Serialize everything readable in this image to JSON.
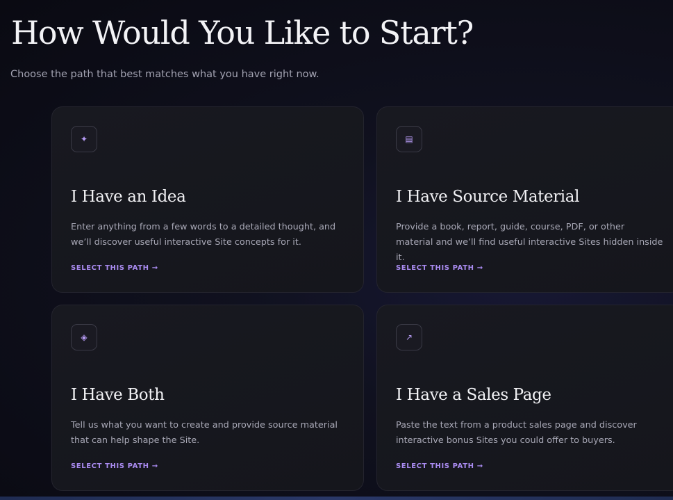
{
  "header": {
    "title": "How Would You Like to Start?",
    "subtitle": "Choose the path that best matches what you have right now."
  },
  "cards": [
    {
      "icon": "sparkle-icon",
      "glyph": "✦",
      "title": "I Have an Idea",
      "description": "Enter anything from a few words to a detailed thought, and we’ll discover useful interactive Site concepts for it.",
      "link": "SELECT THIS PATH →"
    },
    {
      "icon": "document-icon",
      "glyph": "▤",
      "title": "I Have Source Material",
      "description": "Provide a book, report, guide, course, PDF, or other material and we’ll find useful interactive Sites hidden inside it.",
      "link": "SELECT THIS PATH →"
    },
    {
      "icon": "diamond-icon",
      "glyph": "◈",
      "title": "I Have Both",
      "description": "Tell us what you want to create and provide source material that can help shape the Site.",
      "link": "SELECT THIS PATH →"
    },
    {
      "icon": "arrow-up-right-icon",
      "glyph": "↗",
      "title": "I Have a Sales Page",
      "description": "Paste the text from a product sales page and discover interactive bonus Sites you could offer to buyers.",
      "link": "SELECT THIS PATH →"
    }
  ],
  "colors": {
    "accent": "#a98bf0",
    "background": "#0a0a12",
    "card": "#17181e"
  }
}
